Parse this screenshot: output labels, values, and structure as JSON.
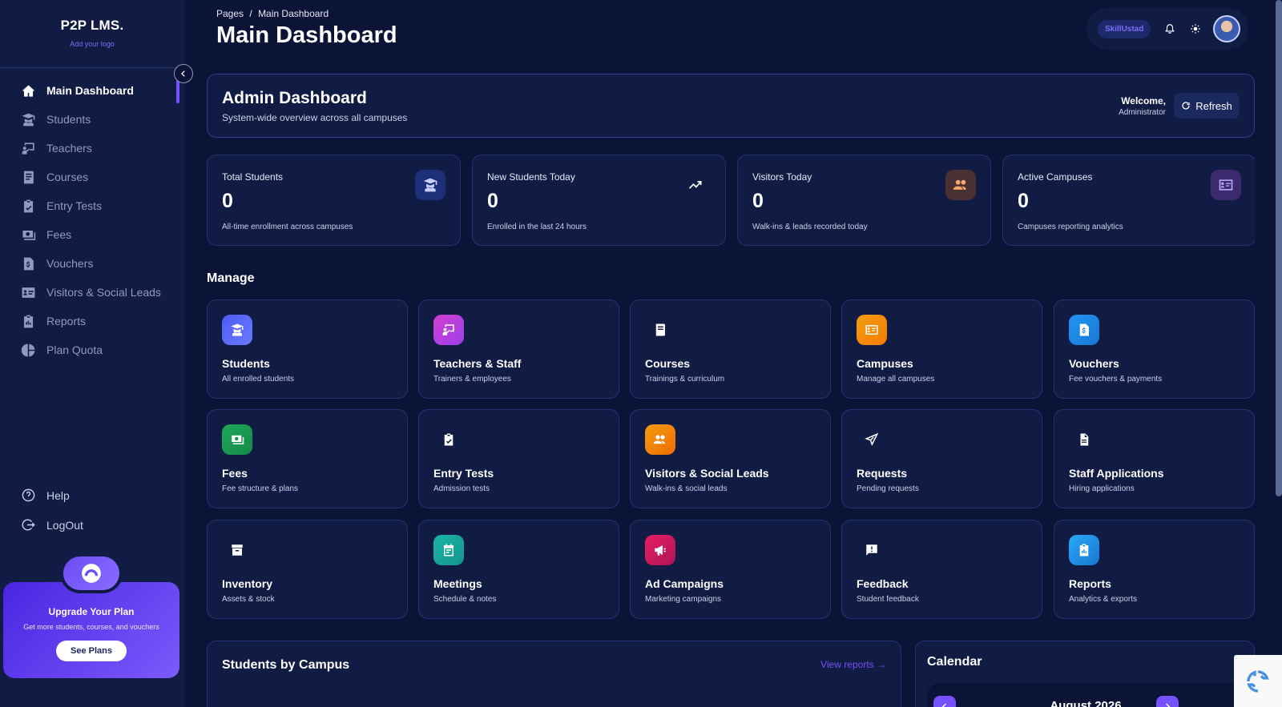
{
  "brand": {
    "name": "P2P LMS.",
    "subtitle": "Add your logo"
  },
  "sidebar": {
    "items": [
      {
        "label": "Main Dashboard",
        "icon": "home-icon",
        "active": true
      },
      {
        "label": "Students",
        "icon": "graduate-icon"
      },
      {
        "label": "Teachers",
        "icon": "teacher-icon"
      },
      {
        "label": "Courses",
        "icon": "book-icon"
      },
      {
        "label": "Entry Tests",
        "icon": "clipboard-check-icon"
      },
      {
        "label": "Fees",
        "icon": "money-icon"
      },
      {
        "label": "Vouchers",
        "icon": "voucher-icon"
      },
      {
        "label": "Visitors & Social Leads",
        "icon": "id-card-icon"
      },
      {
        "label": "Reports",
        "icon": "report-icon"
      },
      {
        "label": "Plan Quota",
        "icon": "pie-chart-icon"
      }
    ],
    "bottom": [
      {
        "label": "Help",
        "icon": "help-icon"
      },
      {
        "label": "LogOut",
        "icon": "logout-icon"
      }
    ]
  },
  "upgrade": {
    "title": "Upgrade Your Plan",
    "subtitle": "Get more students, courses, and vouchers",
    "button": "See Plans"
  },
  "header": {
    "breadcrumb_root": "Pages",
    "breadcrumb_sep": "/",
    "breadcrumb_current": "Main Dashboard",
    "title": "Main Dashboard",
    "tenant": "SkillUstad"
  },
  "admin": {
    "title": "Admin Dashboard",
    "subtitle": "System-wide overview across all campuses",
    "welcome": "Welcome,",
    "role": "Administrator",
    "refresh": "Refresh"
  },
  "stats": [
    {
      "label": "Total Students",
      "value": "0",
      "desc": "All-time enrollment across campuses",
      "icon": "graduate-icon",
      "color": "#1e2f7a"
    },
    {
      "label": "New Students Today",
      "value": "0",
      "desc": "Enrolled in the last 24 hours",
      "icon": "trending-up-icon",
      "color": "#111c44"
    },
    {
      "label": "Visitors Today",
      "value": "0",
      "desc": "Walk-ins & leads recorded today",
      "icon": "users-icon",
      "color": "#4a2f33"
    },
    {
      "label": "Active Campuses",
      "value": "0",
      "desc": "Campuses reporting analytics",
      "icon": "id-card-icon",
      "color": "#3a2a6e"
    }
  ],
  "manage": {
    "title": "Manage",
    "tiles": [
      {
        "title": "Students",
        "sub": "All enrolled students",
        "icon": "graduate-icon",
        "bg": "linear-gradient(135deg,#4c5cf5,#6a7bff)"
      },
      {
        "title": "Teachers & Staff",
        "sub": "Trainers & employees",
        "icon": "teacher-icon",
        "bg": "linear-gradient(135deg,#d23fd0,#9b3fe8)"
      },
      {
        "title": "Courses",
        "sub": "Trainings & curriculum",
        "icon": "book-icon",
        "bg": "#111c44"
      },
      {
        "title": "Campuses",
        "sub": "Manage all campuses",
        "icon": "id-card-icon",
        "bg": "linear-gradient(135deg,#f39c12,#f57c00)"
      },
      {
        "title": "Vouchers",
        "sub": "Fee vouchers & payments",
        "icon": "voucher-icon",
        "bg": "linear-gradient(135deg,#2196f3,#1976d2)"
      },
      {
        "title": "Fees",
        "sub": "Fee structure & plans",
        "icon": "money-icon",
        "bg": "linear-gradient(135deg,#1fa65a,#138a48)"
      },
      {
        "title": "Entry Tests",
        "sub": "Admission tests",
        "icon": "clipboard-check-icon",
        "bg": "#111c44"
      },
      {
        "title": "Visitors & Social Leads",
        "sub": "Walk-ins & social leads",
        "icon": "users-icon",
        "bg": "linear-gradient(135deg,#f39c12,#ef6c00)"
      },
      {
        "title": "Requests",
        "sub": "Pending requests",
        "icon": "send-icon",
        "bg": "#111c44"
      },
      {
        "title": "Staff Applications",
        "sub": "Hiring applications",
        "icon": "document-icon",
        "bg": "#111c44"
      },
      {
        "title": "Inventory",
        "sub": "Assets & stock",
        "icon": "archive-icon",
        "bg": "#111c44"
      },
      {
        "title": "Meetings",
        "sub": "Schedule & notes",
        "icon": "calendar-icon",
        "bg": "linear-gradient(135deg,#1bb5a8,#14968b)"
      },
      {
        "title": "Ad Campaigns",
        "sub": "Marketing campaigns",
        "icon": "megaphone-icon",
        "bg": "linear-gradient(135deg,#e91e63,#ad1457)"
      },
      {
        "title": "Feedback",
        "sub": "Student feedback",
        "icon": "feedback-icon",
        "bg": "#111c44"
      },
      {
        "title": "Reports",
        "sub": "Analytics & exports",
        "icon": "report-icon",
        "bg": "linear-gradient(135deg,#29a8f5,#1976d2)"
      }
    ]
  },
  "students_by_campus": {
    "title": "Students by Campus",
    "link": "View reports"
  },
  "calendar": {
    "title": "Calendar",
    "month": "August 2026"
  },
  "colors": {
    "accent": "#7551ff",
    "background": "#0b1437",
    "card": "#111c44"
  }
}
